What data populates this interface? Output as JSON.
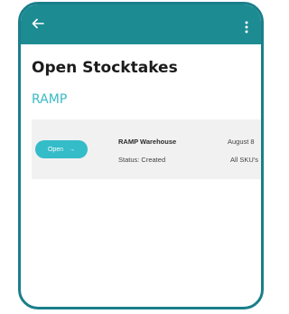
{
  "header": {
    "back_icon": "arrow-left",
    "more_icon": "vertical-dots",
    "bar_color": "#1c8b92"
  },
  "page": {
    "title": "Open Stocktakes",
    "section": "RAMP"
  },
  "stocktakes": [
    {
      "open_label": "Open",
      "open_arrow": "→",
      "warehouse": "RAMP Warehouse",
      "status": "Status: Created",
      "date": "August 8",
      "scope": "All SKU's"
    }
  ],
  "colors": {
    "accent": "#34bcc8",
    "section_title": "#3bbac3",
    "frame": "#1a7f8a",
    "row_bg": "#f1f1f1"
  }
}
